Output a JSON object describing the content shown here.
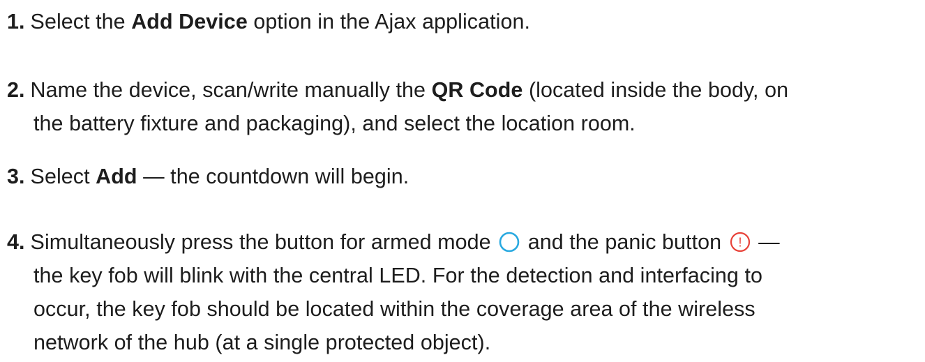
{
  "steps": [
    {
      "number": "1.",
      "parts": [
        "Select the ",
        "Add Device",
        " option in the Ajax application."
      ]
    },
    {
      "number": "2.",
      "parts": [
        "Name the device, scan/write manually the ",
        "QR Code",
        " (located inside the body, on"
      ],
      "continuation": "the battery fixture and packaging), and select the location room."
    },
    {
      "number": "3.",
      "parts": [
        "Select ",
        "Add",
        " — the countdown will begin."
      ]
    },
    {
      "number": "4.",
      "parts": [
        "Simultaneously press the button for armed mode",
        " and the panic button",
        " —"
      ],
      "continuation_lines": [
        "the key fob will blink with the central LED. For the detection and interfacing to",
        "occur, the key fob should be located within the coverage area of the wireless",
        "network of the hub (at a single protected object)."
      ]
    }
  ],
  "icons": {
    "armed_mode": {
      "name": "armed-mode-circle-icon",
      "color": "#29a9e0"
    },
    "panic": {
      "name": "panic-exclamation-icon",
      "color": "#e8433a",
      "glyph": "!"
    }
  }
}
